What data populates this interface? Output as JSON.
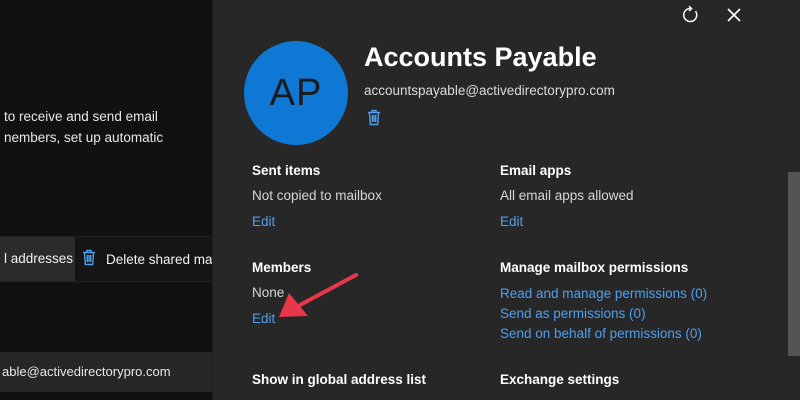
{
  "background": {
    "description_lines": [
      "to receive and send email",
      "nembers, set up automatic"
    ],
    "toolbar": {
      "addresses_label": "l addresses",
      "delete_label": "Delete shared ma"
    },
    "row_email": "able@activedirectorypro.com"
  },
  "panel": {
    "avatar_initials": "AP",
    "title": "Accounts Payable",
    "email": "accountspayable@activedirectorypro.com",
    "icons": {
      "refresh": "refresh-icon",
      "close": "close-icon",
      "delete": "trash-icon"
    },
    "sent_items": {
      "heading": "Sent items",
      "value": "Not copied to mailbox",
      "edit": "Edit"
    },
    "email_apps": {
      "heading": "Email apps",
      "value": "All email apps allowed",
      "edit": "Edit"
    },
    "members": {
      "heading": "Members",
      "value": "None",
      "edit": "Edit"
    },
    "manage_permissions": {
      "heading": "Manage mailbox permissions",
      "links": [
        "Read and manage permissions (0)",
        "Send as permissions (0)",
        "Send on behalf of permissions (0)"
      ]
    },
    "global_address_list": {
      "heading": "Show in global address list"
    },
    "exchange_settings": {
      "heading": "Exchange settings"
    }
  },
  "colors": {
    "accent": "#0f78d4",
    "link": "#4ca0f0",
    "panel_bg": "#272727",
    "annotation_arrow": "#e8374a"
  }
}
